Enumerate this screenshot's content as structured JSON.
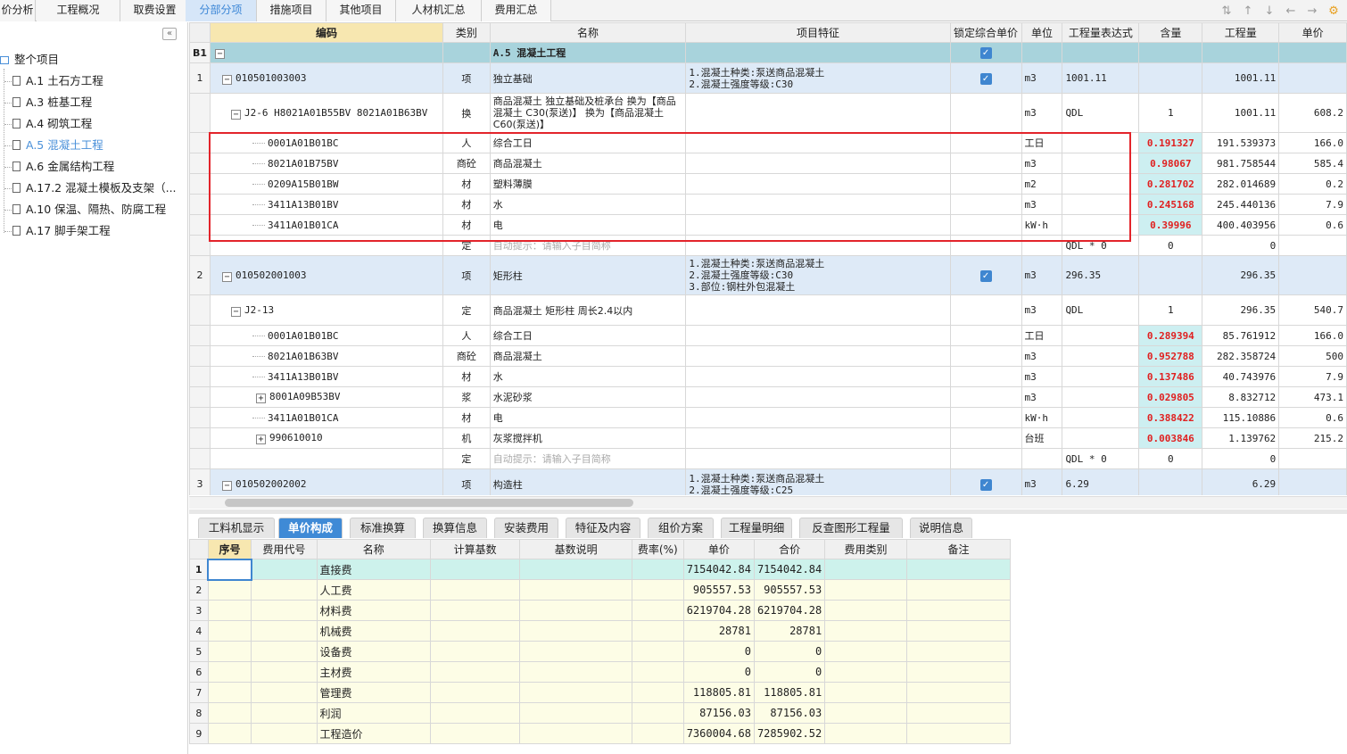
{
  "tabs": [
    {
      "label": "价分析"
    },
    {
      "label": "工程概况"
    },
    {
      "label": "取费设置"
    },
    {
      "label": "分部分项"
    },
    {
      "label": "措施项目"
    },
    {
      "label": "其他项目"
    },
    {
      "label": "人材机汇总"
    },
    {
      "label": "费用汇总"
    }
  ],
  "active_tab_index": 3,
  "tree": {
    "root": "整个项目",
    "items": [
      "A.1 土石方工程",
      "A.3 桩基工程",
      "A.4 砌筑工程",
      "A.5 混凝土工程",
      "A.6 金属结构工程",
      "A.17.2 混凝土模板及支架（...",
      "A.10 保温、隔热、防腐工程",
      "A.17 脚手架工程"
    ],
    "selected_index": 3
  },
  "grid": {
    "headers": [
      "编码",
      "类别",
      "名称",
      "项目特征",
      "锁定综合单价",
      "单位",
      "工程量表达式",
      "含量",
      "工程量",
      "单价"
    ],
    "rows": [
      {
        "type": "head",
        "rn": "B1",
        "code": "",
        "cat": "",
        "name": "A.5  混凝土工程",
        "feat": "",
        "lock": true,
        "unit": "",
        "expr": "",
        "content": "",
        "qty": "",
        "price": ""
      },
      {
        "type": "item",
        "rn": "1",
        "code": "010501003003",
        "cat": "项",
        "name": "独立基础",
        "feat": "1.混凝土种类:泵送商品混凝土\n2.混凝土强度等级:C30",
        "lock": true,
        "unit": "m3",
        "expr": "1001.11",
        "content": "",
        "qty": "1001.11",
        "price": ""
      },
      {
        "type": "quota",
        "rn": "",
        "code": "J2-6 H8021A01B55BV 8021A01B63BV",
        "cat": "换",
        "name": "商品混凝土 独立基础及桩承台  换为【商品混凝土 C30(泵送)】 换为【商品混凝土C60(泵送)】",
        "feat": "",
        "lock": false,
        "unit": "m3",
        "expr": "QDL",
        "content": "1",
        "qty": "1001.11",
        "price": "608.2"
      },
      {
        "type": "sub",
        "rn": "",
        "code": "0001A01B01BC",
        "cat": "人",
        "name": "综合工日",
        "feat": "",
        "lock": false,
        "unit": "工日",
        "expr": "",
        "content": "0.191327",
        "qty": "191.539373",
        "price": "166.0"
      },
      {
        "type": "sub",
        "rn": "",
        "code": "8021A01B75BV",
        "cat": "商砼",
        "name": "商品混凝土",
        "feat": "",
        "lock": false,
        "unit": "m3",
        "expr": "",
        "content": "0.98067",
        "qty": "981.758544",
        "price": "585.4"
      },
      {
        "type": "sub",
        "rn": "",
        "code": "0209A15B01BW",
        "cat": "材",
        "name": "塑料薄膜",
        "feat": "",
        "lock": false,
        "unit": "m2",
        "expr": "",
        "content": "0.281702",
        "qty": "282.014689",
        "price": "0.2"
      },
      {
        "type": "sub",
        "rn": "",
        "code": "3411A13B01BV",
        "cat": "材",
        "name": "水",
        "feat": "",
        "lock": false,
        "unit": "m3",
        "expr": "",
        "content": "0.245168",
        "qty": "245.440136",
        "price": "7.9"
      },
      {
        "type": "sub",
        "rn": "",
        "code": "3411A01B01CA",
        "cat": "材",
        "name": "电",
        "feat": "",
        "lock": false,
        "unit": "kW·h",
        "expr": "",
        "content": "0.39996",
        "qty": "400.403956",
        "price": "0.6"
      },
      {
        "type": "hint",
        "rn": "",
        "code": "",
        "cat": "定",
        "name": "自动提示：请输入子目简称",
        "feat": "",
        "lock": false,
        "unit": "",
        "expr": "QDL * 0",
        "content": "0",
        "qty": "0",
        "price": ""
      },
      {
        "type": "item",
        "rn": "2",
        "code": "010502001003",
        "cat": "项",
        "name": "矩形柱",
        "feat": "1.混凝土种类:泵送商品混凝土\n2.混凝土强度等级:C30\n3.部位:钢柱外包混凝土",
        "lock": true,
        "unit": "m3",
        "expr": "296.35",
        "content": "",
        "qty": "296.35",
        "price": ""
      },
      {
        "type": "quota",
        "rn": "",
        "code": "J2-13",
        "cat": "定",
        "name": "商品混凝土 矩形柱 周长2.4以内",
        "feat": "",
        "lock": false,
        "unit": "m3",
        "expr": "QDL",
        "content": "1",
        "qty": "296.35",
        "price": "540.7"
      },
      {
        "type": "sub",
        "rn": "",
        "code": "0001A01B01BC",
        "cat": "人",
        "name": "综合工日",
        "feat": "",
        "lock": false,
        "unit": "工日",
        "expr": "",
        "content": "0.289394",
        "qty": "85.761912",
        "price": "166.0"
      },
      {
        "type": "sub",
        "rn": "",
        "code": "8021A01B63BV",
        "cat": "商砼",
        "name": "商品混凝土",
        "feat": "",
        "lock": false,
        "unit": "m3",
        "expr": "",
        "content": "0.952788",
        "qty": "282.358724",
        "price": "500"
      },
      {
        "type": "sub",
        "rn": "",
        "code": "3411A13B01BV",
        "cat": "材",
        "name": "水",
        "feat": "",
        "lock": false,
        "unit": "m3",
        "expr": "",
        "content": "0.137486",
        "qty": "40.743976",
        "price": "7.9"
      },
      {
        "type": "subplus",
        "rn": "",
        "code": "8001A09B53BV",
        "cat": "浆",
        "name": "水泥砂浆",
        "feat": "",
        "lock": false,
        "unit": "m3",
        "expr": "",
        "content": "0.029805",
        "qty": "8.832712",
        "price": "473.1"
      },
      {
        "type": "sub",
        "rn": "",
        "code": "3411A01B01CA",
        "cat": "材",
        "name": "电",
        "feat": "",
        "lock": false,
        "unit": "kW·h",
        "expr": "",
        "content": "0.388422",
        "qty": "115.10886",
        "price": "0.6"
      },
      {
        "type": "subplus",
        "rn": "",
        "code": "990610010",
        "cat": "机",
        "name": "灰浆搅拌机",
        "feat": "",
        "lock": false,
        "unit": "台班",
        "expr": "",
        "content": "0.003846",
        "qty": "1.139762",
        "price": "215.2"
      },
      {
        "type": "hint",
        "rn": "",
        "code": "",
        "cat": "定",
        "name": "自动提示：请输入子目简称",
        "feat": "",
        "lock": false,
        "unit": "",
        "expr": "QDL * 0",
        "content": "0",
        "qty": "0",
        "price": ""
      },
      {
        "type": "item",
        "rn": "3",
        "code": "010502002002",
        "cat": "项",
        "name": "构造柱",
        "feat": "1.混凝土种类:泵送商品混凝土\n2.混凝土强度等级:C25",
        "lock": true,
        "unit": "m3",
        "expr": "6.29",
        "content": "",
        "qty": "6.29",
        "price": ""
      }
    ]
  },
  "bottom_tabs": [
    {
      "label": "工料机显示"
    },
    {
      "label": "单价构成"
    },
    {
      "label": "标准换算"
    },
    {
      "label": "换算信息"
    },
    {
      "label": "安装费用"
    },
    {
      "label": "特征及内容"
    },
    {
      "label": "组价方案"
    },
    {
      "label": "工程量明细"
    },
    {
      "label": "反查图形工程量"
    },
    {
      "label": "说明信息"
    }
  ],
  "bottom_active_index": 1,
  "bottom_grid": {
    "headers": [
      "序号",
      "费用代号",
      "名称",
      "计算基数",
      "基数说明",
      "费率(%)",
      "单价",
      "合价",
      "费用类别",
      "备注"
    ],
    "rows": [
      {
        "n": "1",
        "name": "直接费",
        "unit_price": "7154042.84",
        "total": "7154042.84"
      },
      {
        "n": "2",
        "name": "人工费",
        "unit_price": "905557.53",
        "total": "905557.53"
      },
      {
        "n": "3",
        "name": "材料费",
        "unit_price": "6219704.28",
        "total": "6219704.28"
      },
      {
        "n": "4",
        "name": "机械费",
        "unit_price": "28781",
        "total": "28781"
      },
      {
        "n": "5",
        "name": "设备费",
        "unit_price": "0",
        "total": "0"
      },
      {
        "n": "6",
        "name": "主材费",
        "unit_price": "0",
        "total": "0"
      },
      {
        "n": "7",
        "name": "管理费",
        "unit_price": "118805.81",
        "total": "118805.81"
      },
      {
        "n": "8",
        "name": "利润",
        "unit_price": "87156.03",
        "total": "87156.03"
      },
      {
        "n": "9",
        "name": "工程造价",
        "unit_price": "7360004.68",
        "total": "7285902.52"
      }
    ]
  }
}
